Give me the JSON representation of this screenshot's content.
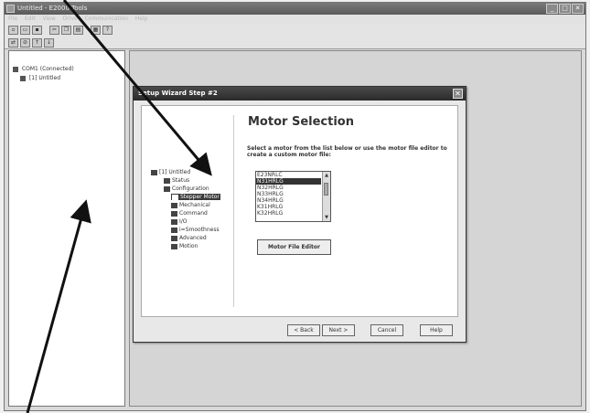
{
  "window": {
    "title": "Untitled - E2000 Tools",
    "menu": [
      "File",
      "Edit",
      "View",
      "Drive",
      "Communication",
      "Help"
    ]
  },
  "toolbar": {
    "row1": [
      "new",
      "open",
      "save",
      "cut",
      "copy",
      "paste",
      "print",
      "help"
    ],
    "row2": [
      "connect",
      "disconnect",
      "upload",
      "download"
    ]
  },
  "tree": {
    "root": "COM1 (Connected)",
    "child": "[1] Untitled"
  },
  "dialog": {
    "title": "Setup Wizard Step #2",
    "close_glyph": "✕",
    "heading": "Motor Selection",
    "instruction": "Select a motor from the list below or use the motor file editor to create a custom motor file:",
    "nav": [
      {
        "label": "[1] Untitled"
      },
      {
        "label": "Status"
      },
      {
        "label": "Configuration"
      },
      {
        "label": "Stepper Motor"
      },
      {
        "label": "Mechanical"
      },
      {
        "label": "Command"
      },
      {
        "label": "I/O"
      },
      {
        "label": "i=Smoothness"
      },
      {
        "label": "Advanced"
      },
      {
        "label": "Motion"
      }
    ],
    "motors": [
      "E23NRLC",
      "N31HRLG",
      "N32HRLG",
      "N33HRLG",
      "N34HRLG",
      "K31HRLG",
      "K32HRLG"
    ],
    "selected_motor": "N31HRLG",
    "motor_file_editor_label": "Motor File Editor",
    "back_label": "< Back",
    "next_label": "Next >",
    "cancel_label": "Cancel",
    "help_label": "Help"
  }
}
